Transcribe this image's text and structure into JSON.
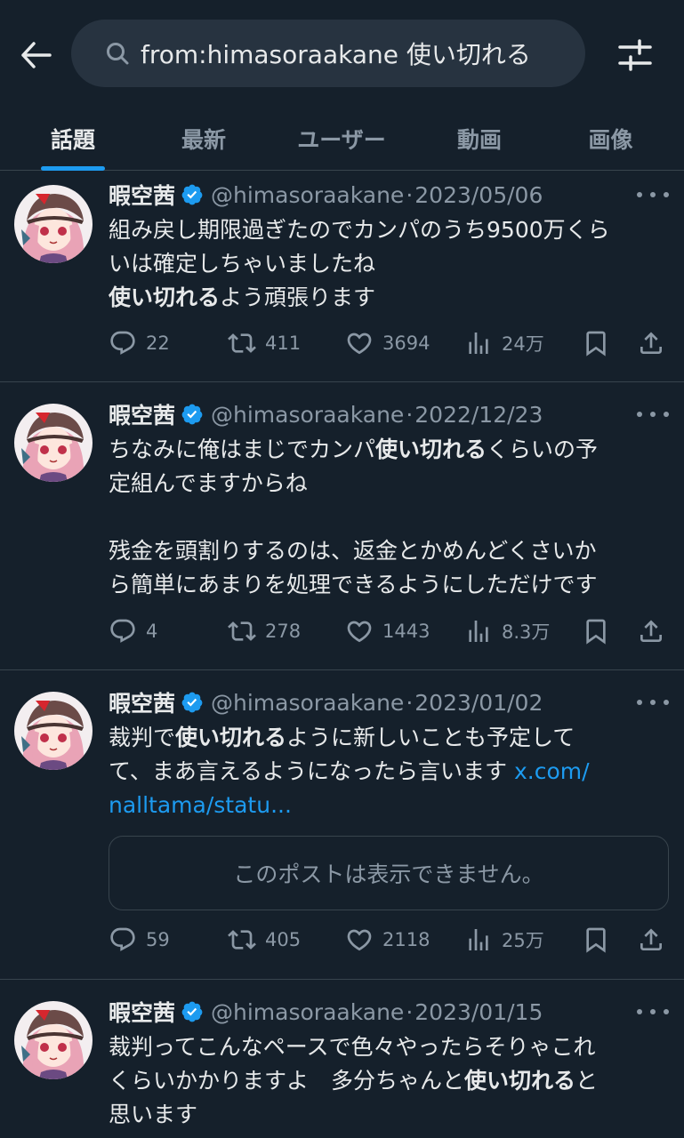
{
  "search": {
    "query": "from:himasoraakane 使い切れる"
  },
  "tabs": [
    {
      "label": "話題",
      "active": true
    },
    {
      "label": "最新"
    },
    {
      "label": "ユーザー"
    },
    {
      "label": "動画"
    },
    {
      "label": "画像"
    }
  ],
  "colors": {
    "background": "#15202b",
    "accent": "#1d9bf0",
    "muted": "#8b98a5",
    "text": "#e7e9ea",
    "border": "#38444d"
  },
  "tweets": [
    {
      "name": "暇空茜",
      "handle": "@himasoraakane",
      "dot": "·",
      "date": "2023/05/06",
      "body_l1": "組み戻し期限過ぎたのでカンパのうち9500万くら",
      "body_l2": "いは確定しちゃいましたね",
      "body_l3_bold": "使い切れる",
      "body_l3_rest": "よう頑張ります",
      "replies": "22",
      "reposts": "411",
      "likes": "3694",
      "views": "24万"
    },
    {
      "name": "暇空茜",
      "handle": "@himasoraakane",
      "dot": "·",
      "date": "2022/12/23",
      "body_l1_pre": "ちなみに俺はまじでカンパ",
      "body_l1_bold": "使い切れる",
      "body_l1_post": "くらいの予",
      "body_l2": "定組んでますからね",
      "body_l3": "残金を頭割りするのは、返金とかめんどくさいか",
      "body_l4": "ら簡単にあまりを処理できるようにしただけです",
      "replies": "4",
      "reposts": "278",
      "likes": "1443",
      "views": "8.3万"
    },
    {
      "name": "暇空茜",
      "handle": "@himasoraakane",
      "dot": "·",
      "date": "2023/01/02",
      "body_l1_pre": "裁判で",
      "body_l1_bold": "使い切れる",
      "body_l1_post": "ように新しいことも予定して",
      "body_l2_pre": "て、まあ言えるようになったら言います ",
      "body_l2_link": "x.com/",
      "body_l3_link": "nalltama/statu...",
      "quoted_unavailable": "このポストは表示できません。",
      "replies": "59",
      "reposts": "405",
      "likes": "2118",
      "views": "25万"
    },
    {
      "name": "暇空茜",
      "handle": "@himasoraakane",
      "dot": "·",
      "date": "2023/01/15",
      "body_l1": "裁判ってこんなペースで色々やったらそりゃこれ",
      "body_l2_pre": "くらいかかりますよ　多分ちゃんと",
      "body_l2_bold": "使い切れる",
      "body_l2_post": "と",
      "body_l3": "思います"
    }
  ]
}
